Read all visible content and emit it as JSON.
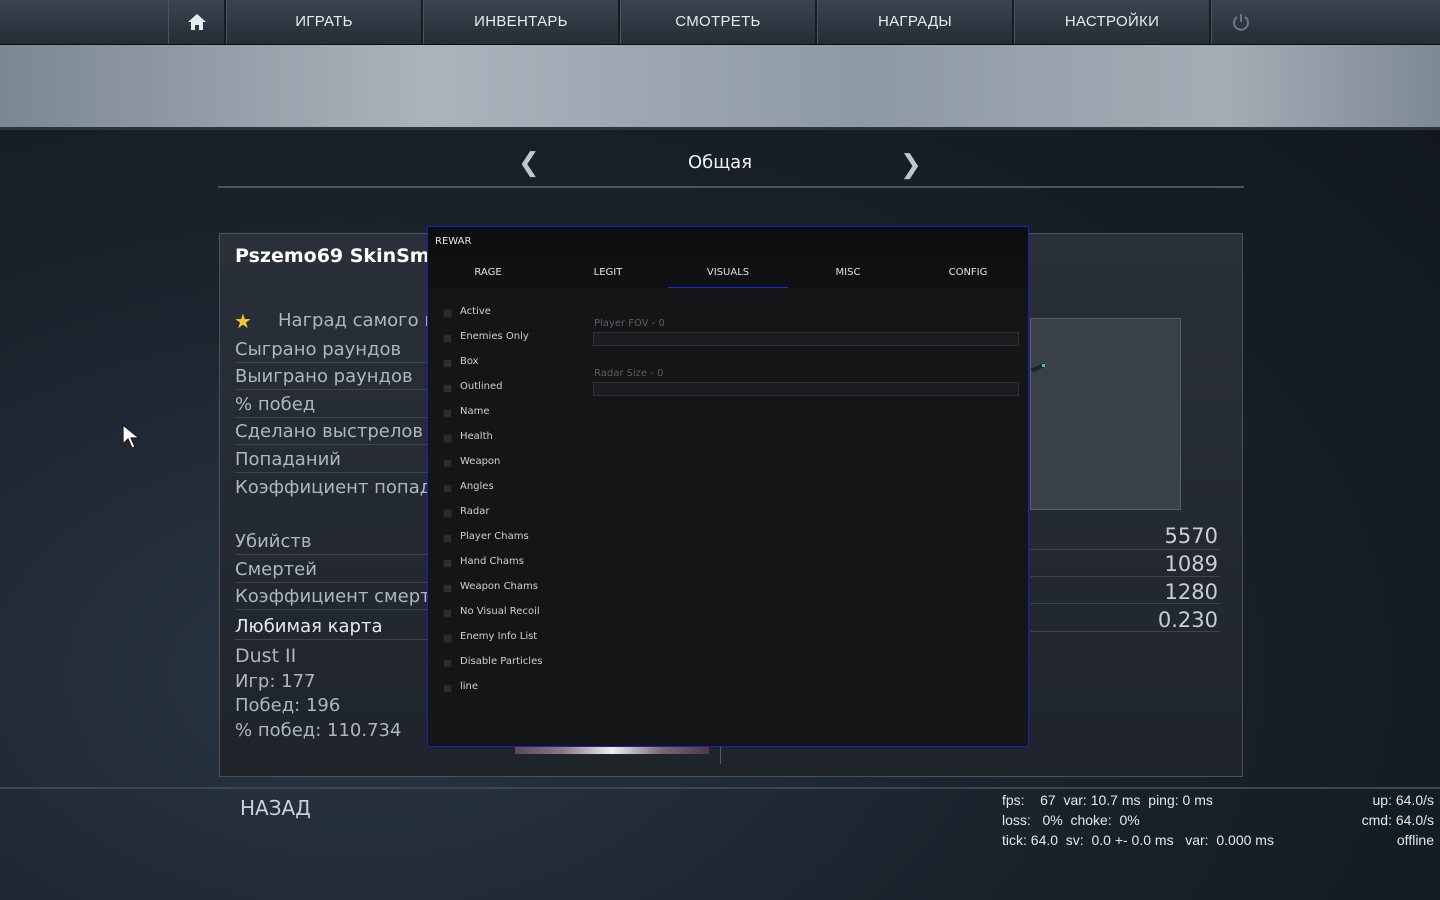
{
  "nav": {
    "items": [
      "ИГРАТЬ",
      "ИНВЕНТАРЬ",
      "СМОТРЕТЬ",
      "НАГРАДЫ",
      "НАСТРОЙКИ"
    ]
  },
  "category": {
    "title": "Общая"
  },
  "player": {
    "name": "Pszemo69 SkinSmas"
  },
  "stats": {
    "labels": [
      "Наград самого це",
      "Сыграно раундов",
      "Выиграно раундов",
      "% побед",
      "Сделано выстрелов",
      "Попаданий",
      "Коэффициент попада",
      "Убийств",
      "Смертей",
      "Коэффициент смерте",
      "Любимая карта",
      "Dust II",
      "Игр: 177",
      "Побед: 196",
      "% побед: 110.734"
    ],
    "values": [
      "5570",
      "1089",
      "1280",
      "0.230"
    ]
  },
  "back_label": "НАЗАД",
  "netgraph": {
    "line1": "fps:    67  var: 10.7 ms  ping: 0 ms",
    "line2": "loss:   0%  choke:  0%",
    "line3": "tick: 64.0  sv:  0.0 +- 0.0 ms   var:  0.000 ms",
    "r1": "up: 64.0/s",
    "r2": "cmd: 64.0/s",
    "r3": "offline"
  },
  "menu": {
    "title": "REWAR",
    "tabs": [
      "RAGE",
      "LEGIT",
      "VISUALS",
      "MISC",
      "CONFIG"
    ],
    "active_tab": "VISUALS",
    "accent_color": "#1d28e0",
    "checkboxes": [
      "Active",
      "Enemies Only",
      "Box",
      "Outlined",
      "Name",
      "Health",
      "Weapon",
      "Angles",
      "Radar",
      "Player Chams",
      "Hand Chams",
      "Weapon Chams",
      "No Visual Recoil",
      "Enemy Info List",
      "Disable Particles",
      "line"
    ],
    "sliders": [
      {
        "label": "Player FOV - 0",
        "value": 0
      },
      {
        "label": "Radar Size - 0",
        "value": 0
      }
    ]
  },
  "icons": {
    "home": "home-icon",
    "power": "power-icon",
    "star": "star-icon",
    "cursor": "cursor-icon",
    "prev": "chevron-left-icon",
    "next": "chevron-right-icon"
  }
}
